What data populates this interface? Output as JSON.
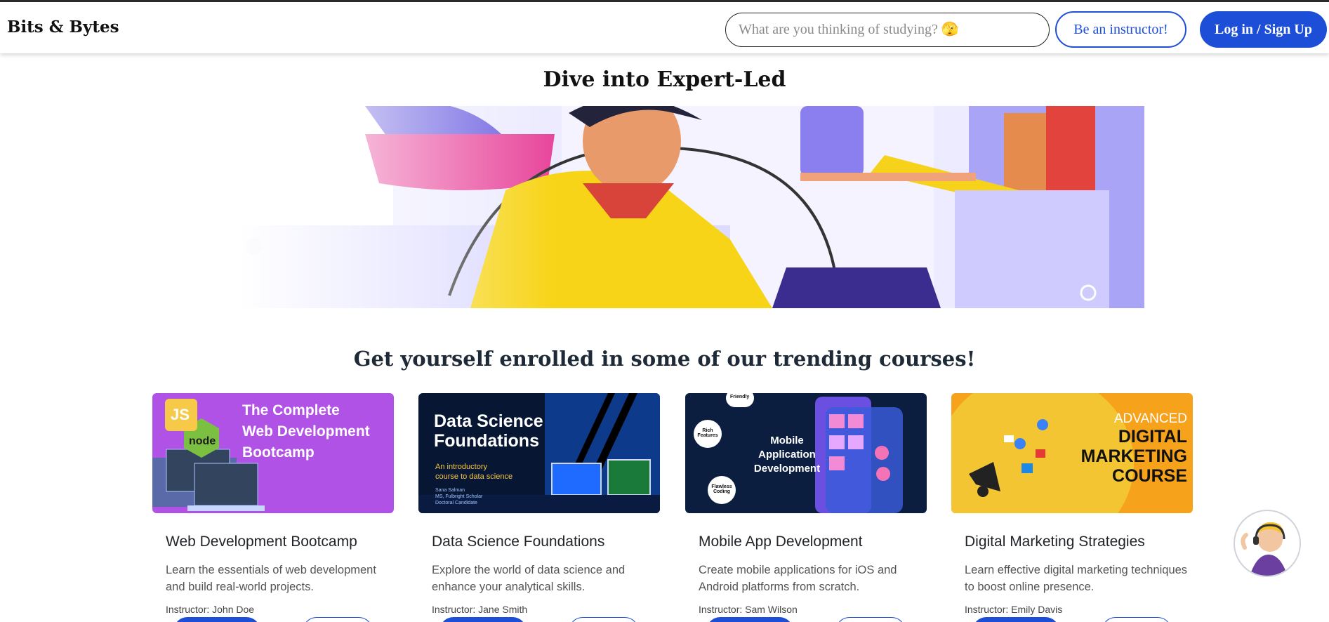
{
  "navbar": {
    "brand": "Bits & Bytes",
    "search_placeholder": "What are you thinking of studying? 🫣",
    "instructor_label": "Be an instructor!",
    "login_label": "Log in / Sign Up"
  },
  "hero": {
    "title": "Dive into Expert-Led"
  },
  "courses_section": {
    "title": "Get yourself enrolled in some of our trending courses!",
    "courses": [
      {
        "title": "Web Development Bootcamp",
        "description": "Learn the essentials of web development and build real-world projects.",
        "instructor": "Instructor: John Doe",
        "thumb_lines": [
          "The Complete",
          "Web Development",
          "Bootcamp"
        ],
        "thumb_badge_js": "JS",
        "thumb_badge_node": "node",
        "thumb_color": "#a855f7"
      },
      {
        "title": "Data Science Foundations",
        "description": "Explore the world of data science and enhance your analytical skills.",
        "instructor": "Instructor: Jane Smith",
        "thumb_lines": [
          "Data Science",
          "Foundations"
        ],
        "thumb_sub": [
          "An introductory",
          "course to data science"
        ],
        "thumb_author": [
          "Sana Salman",
          "MS, Fulbright Scholar",
          "Doctoral Candidate"
        ],
        "thumb_color": "#0a1a3a"
      },
      {
        "title": "Mobile App Development",
        "description": "Create mobile applications for iOS and Android platforms from scratch.",
        "instructor": "Instructor: Sam Wilson",
        "thumb_lines": [
          "Mobile",
          "Application",
          "Development"
        ],
        "thumb_bubbles": [
          "Friendly",
          "Rich Features",
          "Flawless Coding"
        ],
        "thumb_color": "#0b1e3f"
      },
      {
        "title": "Digital Marketing Strategies",
        "description": "Learn effective digital marketing techniques to boost online presence.",
        "instructor": "Instructor: Emily Davis",
        "thumb_lines": [
          "ADVANCED",
          "DIGITAL",
          "MARKETING",
          "COURSE"
        ],
        "thumb_color": "#f7a21b"
      }
    ]
  },
  "colors": {
    "primary": "#1d4ed8",
    "hero_bg": "#a9a4f5"
  }
}
